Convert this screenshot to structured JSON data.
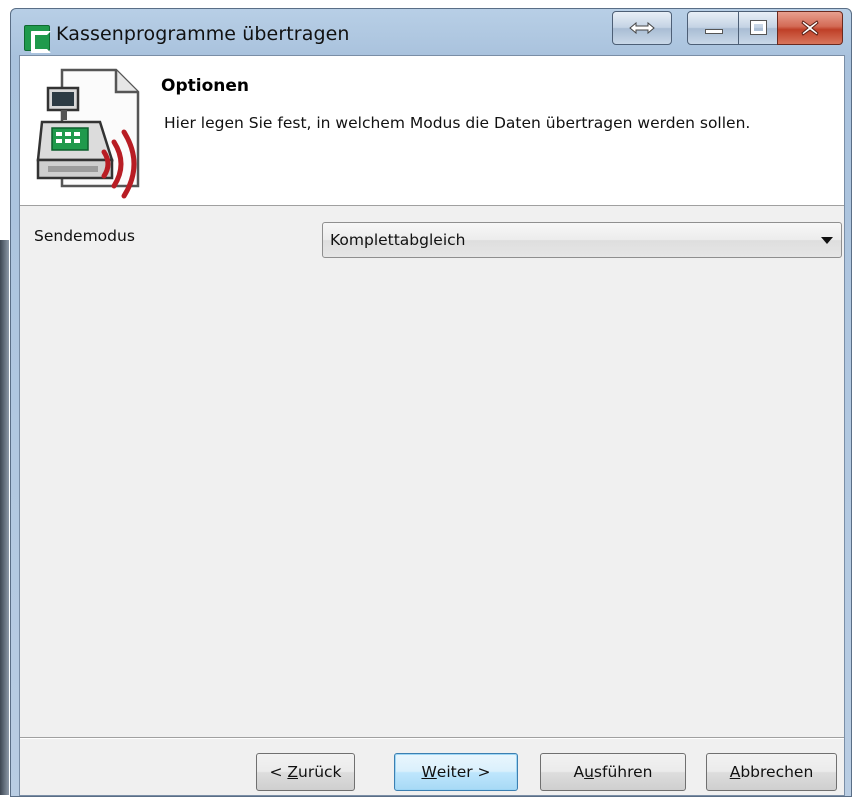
{
  "window": {
    "title": "Kassenprogramme übertragen"
  },
  "header": {
    "title": "Optionen",
    "description": "Hier legen Sie fest, in welchem Modus die Daten übertragen werden sollen."
  },
  "form": {
    "send_mode_label": "Sendemodus",
    "send_mode_value": "Komplettabgleich"
  },
  "buttons": {
    "back_prefix": "< ",
    "back_mnemonic": "Z",
    "back_rest": "urück",
    "next_mnemonic": "W",
    "next_rest": "eiter >",
    "run_prefix": "A",
    "run_mnemonic": "u",
    "run_rest": "sführen",
    "cancel_mnemonic": "A",
    "cancel_rest": "bbrechen"
  },
  "colors": {
    "app_icon": "#1f9a4c",
    "close_button": "#c8452d",
    "wave_red": "#b81d24"
  },
  "icons": {
    "app": "app-icon",
    "header": "cash-register-transmit-icon",
    "dropdown": "chevron-down-icon"
  }
}
